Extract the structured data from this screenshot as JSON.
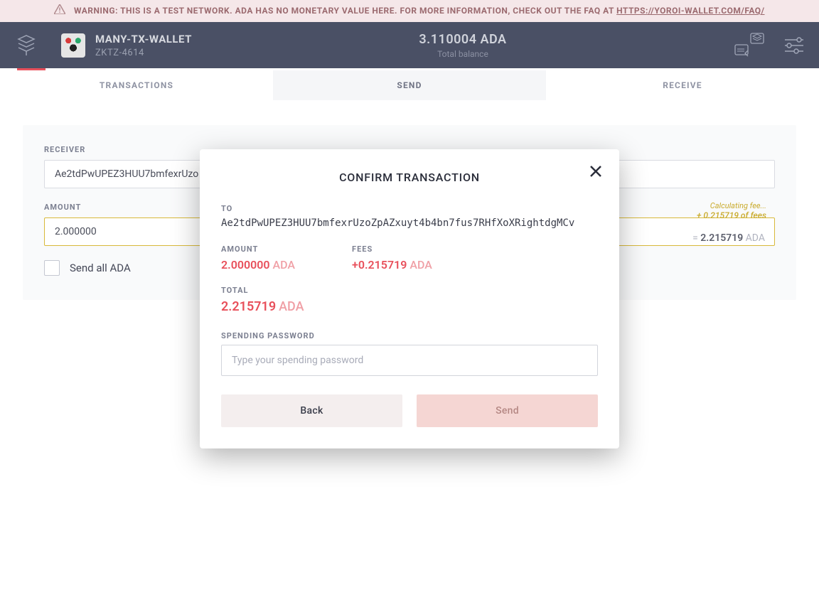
{
  "warning": {
    "prefix": "WARNING: THIS IS A TEST NETWORK. ADA HAS NO MONETARY VALUE HERE. FOR MORE INFORMATION, CHECK OUT THE FAQ AT ",
    "link_text": "HTTPS://YOROI-WALLET.COM/FAQ/"
  },
  "header": {
    "wallet_name": "MANY-TX-WALLET",
    "wallet_code": "ZKTZ-4614",
    "balance_value": "3.110004 ADA",
    "balance_label": "Total balance"
  },
  "tabs": {
    "transactions": "TRANSACTIONS",
    "send": "SEND",
    "receive": "RECEIVE"
  },
  "send_form": {
    "receiver_label": "RECEIVER",
    "receiver_value": "Ae2tdPwUPEZ3HUU7bmfexrUzo",
    "amount_label": "AMOUNT",
    "amount_value": "2.000000",
    "calculating_text": "Calculating fee...",
    "fees_inline": "+ 0.215719 of fees",
    "total_eq": "= ",
    "total_strong": "2.215719",
    "total_unit": " ADA",
    "send_all_label": "Send all ADA"
  },
  "modal": {
    "title": "CONFIRM TRANSACTION",
    "to_label": "TO",
    "to_value": "Ae2tdPwUPEZ3HUU7bmfexrUzoZpAZxuyt4b4bn7fus7RHfXoXRightdgMCv",
    "amount_label": "AMOUNT",
    "amount_value": "2.000000",
    "amount_unit": "ADA",
    "fees_label": "FEES",
    "fees_value": "+0.215719",
    "fees_unit": "ADA",
    "total_label": "TOTAL",
    "total_value": "2.215719",
    "total_unit": "ADA",
    "spending_password_label": "SPENDING PASSWORD",
    "spending_password_placeholder": "Type your spending password",
    "back_label": "Back",
    "send_label": "Send"
  }
}
